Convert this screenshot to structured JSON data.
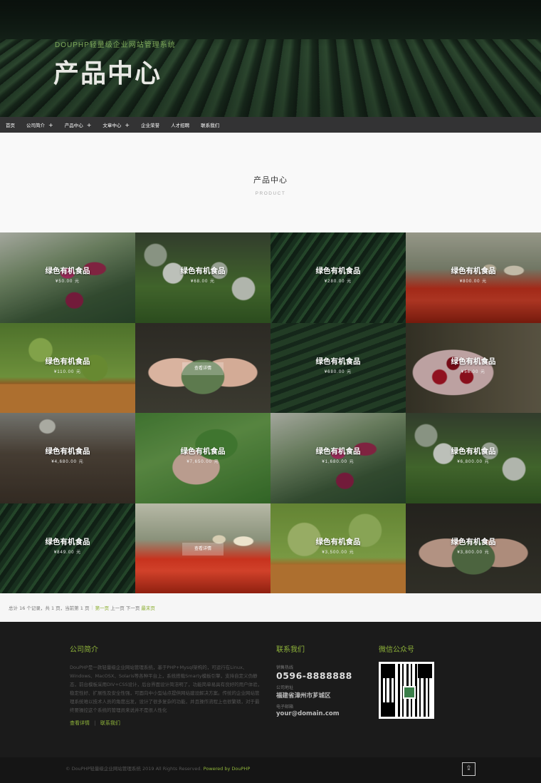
{
  "banner": {
    "subtitle": "DOUPHP轻量级企业网站管理系统",
    "title": "产品中心"
  },
  "nav": {
    "items": [
      {
        "label": "首页"
      },
      {
        "label": "公司简介",
        "plus": "+"
      },
      {
        "label": "产品中心",
        "plus": "+"
      },
      {
        "label": "文章中心",
        "plus": "+"
      },
      {
        "label": "企业荣誉"
      },
      {
        "label": "人才招聘"
      },
      {
        "label": "联系我们"
      }
    ]
  },
  "heading": {
    "title": "产品中心",
    "subtitle": "PRODUCT"
  },
  "products": [
    {
      "name": "绿色有机食品",
      "price": "¥50.00 元"
    },
    {
      "name": "绿色有机食品",
      "price": "¥68.00 元"
    },
    {
      "name": "绿色有机食品",
      "price": "¥280.00 元"
    },
    {
      "name": "绿色有机食品",
      "price": "¥800.00 元"
    },
    {
      "name": "绿色有机食品",
      "price": "¥110.00 元"
    },
    {
      "detail": "查看详情"
    },
    {
      "name": "绿色有机食品",
      "price": "¥680.00 元"
    },
    {
      "name": "绿色有机食品",
      "price": "¥56.00 元"
    },
    {
      "name": "绿色有机食品",
      "price": "¥4,680.00 元"
    },
    {
      "name": "绿色有机食品",
      "price": "¥7,650.00 元"
    },
    {
      "name": "绿色有机食品",
      "price": "¥1,680.00 元"
    },
    {
      "name": "绿色有机食品",
      "price": "¥6,800.00 元"
    },
    {
      "name": "绿色有机食品",
      "price": "¥849.00 元"
    },
    {
      "detail": "查看详情"
    },
    {
      "name": "绿色有机食品",
      "price": "¥3,500.00 元"
    },
    {
      "name": "绿色有机食品",
      "price": "¥3,800.00 元"
    }
  ],
  "pager": {
    "summary": "总计 16 个记录，共 1 页，当前第 1 页",
    "first": "第一页",
    "prev": "上一页",
    "next": "下一页",
    "last": "最末页"
  },
  "footer": {
    "about_title": "公司简介",
    "about_text": "DouPHP是一款轻量级企业网站管理系统，基于PHP+Mysql架构的，可运行在Linux、Windows、MacOSX、Solaris等各种平台上，系统搭载Smarty模板引擎，支持自定义伪静态，前台模板采用DIV+CSS设计，后台界面设计简洁明了，功能简单易具有良好的用户体验，稳定性好、扩展性及安全性强，可面向中小型站点提供网站建设解决方案。传统的企业网站管理系统难以技术人员的角度出发，设计了很多复杂的功能，并且操作流程上也很繁琐，对于最终要操控这个系统的管理员来说并不是很人性化",
    "more_link": "查看详情",
    "contact_link": "联系我们",
    "contact_title": "联系我们",
    "phone_label": "销售热线",
    "phone": "0596-8888888",
    "address_label": "公司地址",
    "address": "福建省漳州市芗城区",
    "email_label": "电子邮箱",
    "email": "your@domain.com",
    "wechat_title": "微信公众号"
  },
  "copyright": {
    "text": "© DouPHP轻量级企业网站管理系统 2019 All Rights Reserved.",
    "powered": "Powered by DouPHP"
  },
  "icons": {
    "back_to_top": "double-chevron-up-icon",
    "qr": "qr-code-icon"
  },
  "colors": {
    "accent": "#8fb43a",
    "nav_bg": "#333334",
    "footer_bg": "#1b1b1b"
  }
}
